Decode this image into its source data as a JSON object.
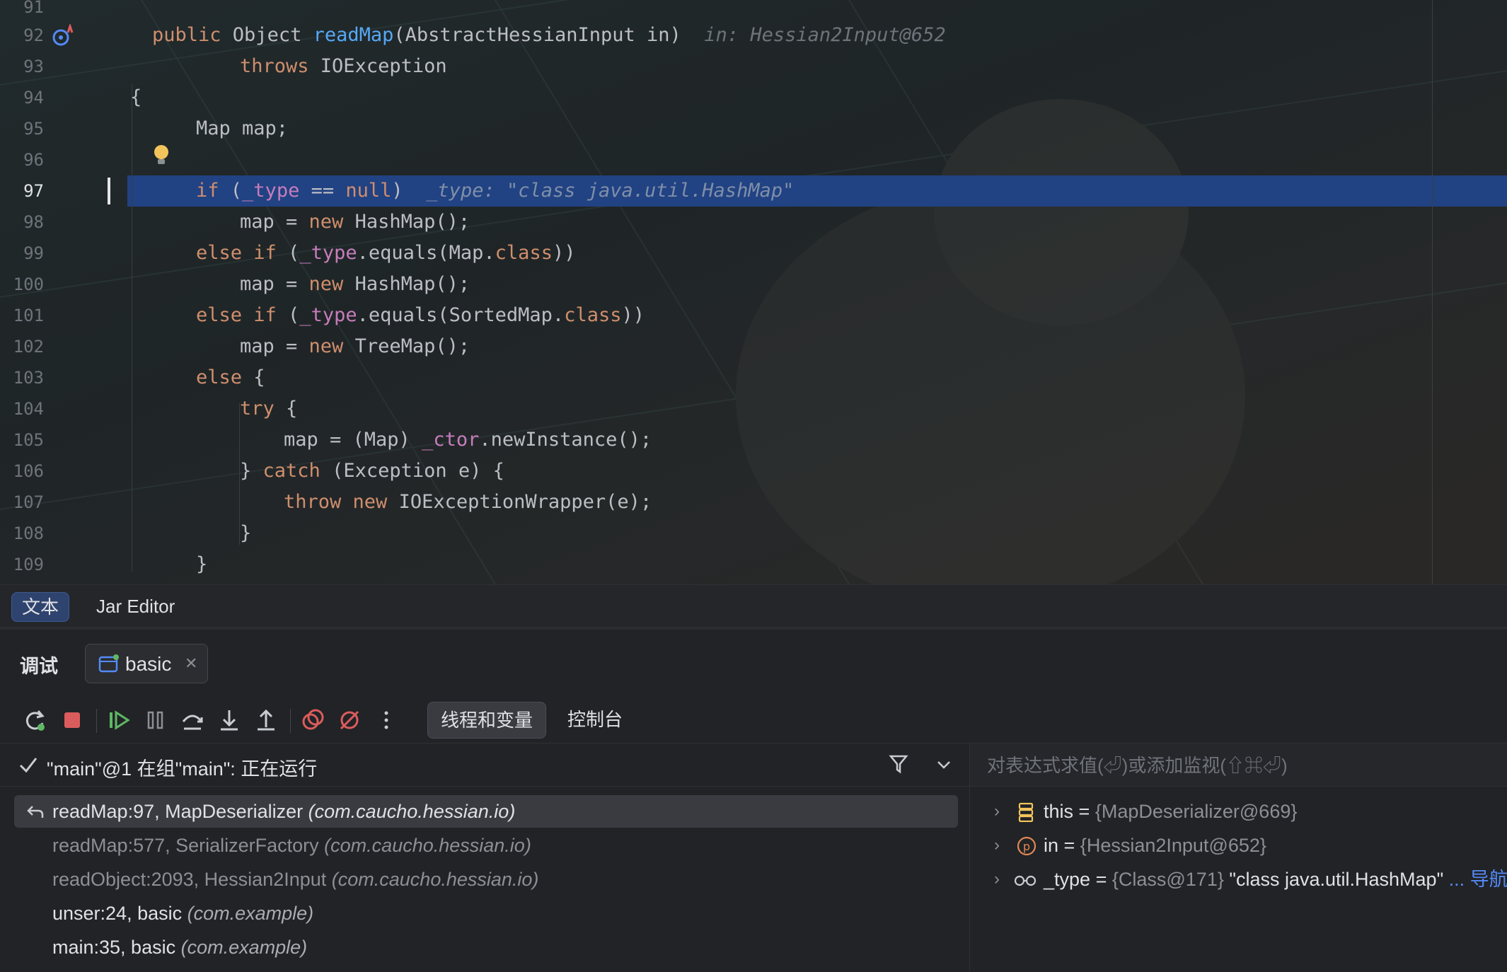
{
  "editor": {
    "lines": [
      {
        "num": "91"
      },
      {
        "num": "92"
      },
      {
        "num": "93"
      },
      {
        "num": "94"
      },
      {
        "num": "95"
      },
      {
        "num": "96"
      },
      {
        "num": "97"
      },
      {
        "num": "98"
      },
      {
        "num": "99"
      },
      {
        "num": "100"
      },
      {
        "num": "101"
      },
      {
        "num": "102"
      },
      {
        "num": "103"
      },
      {
        "num": "104"
      },
      {
        "num": "105"
      },
      {
        "num": "106"
      },
      {
        "num": "107"
      },
      {
        "num": "108"
      },
      {
        "num": "109"
      }
    ],
    "code": {
      "l92_a": "public ",
      "l92_b": "Object ",
      "l92_c": "readMap",
      "l92_d": "(AbstractHessianInput in)",
      "l92_hint": "in: Hessian2Input@652",
      "l93_a": "throws ",
      "l93_b": "IOException",
      "l94": "{",
      "l95": "Map map;",
      "l97_a": "if ",
      "l97_b": "(",
      "l97_c": "_type",
      "l97_d": " == ",
      "l97_e": "null",
      "l97_f": ")",
      "l97_hint": "_type: \"class java.util.HashMap\"",
      "l98_a": "map = ",
      "l98_b": "new ",
      "l98_c": "HashMap();",
      "l99_a": "else if ",
      "l99_b": "(",
      "l99_c": "_type",
      "l99_d": ".equals(Map.",
      "l99_e": "class",
      "l99_f": "))",
      "l100_a": "map = ",
      "l100_b": "new ",
      "l100_c": "HashMap();",
      "l101_a": "else if ",
      "l101_b": "(",
      "l101_c": "_type",
      "l101_d": ".equals(SortedMap.",
      "l101_e": "class",
      "l101_f": "))",
      "l102_a": "map = ",
      "l102_b": "new ",
      "l102_c": "TreeMap();",
      "l103_a": "else ",
      "l103_b": "{",
      "l104_a": "try ",
      "l104_b": "{",
      "l105_a": "map = (Map) ",
      "l105_b": "_ctor",
      "l105_c": ".newInstance();",
      "l106_a": "} ",
      "l106_b": "catch ",
      "l106_c": "(Exception e) {",
      "l107_a": "throw ",
      "l107_b": "new ",
      "l107_c": "IOExceptionWrapper(e);",
      "l108": "}",
      "l109": "}"
    }
  },
  "editor_tabs": [
    {
      "label": "文本",
      "active": true
    },
    {
      "label": "Jar Editor",
      "active": false
    }
  ],
  "debug": {
    "title": "调试",
    "session": "basic",
    "view_tabs": [
      {
        "label": "线程和变量",
        "active": true
      },
      {
        "label": "控制台",
        "active": false
      }
    ],
    "thread_status": "\"main\"@1 在组\"main\": 正在运行",
    "frames": [
      {
        "name": "readMap:97, MapDeserializer ",
        "pkg": "(com.caucho.hessian.io)"
      },
      {
        "name": "readMap:577, SerializerFactory ",
        "pkg": "(com.caucho.hessian.io)"
      },
      {
        "name": "readObject:2093, Hessian2Input ",
        "pkg": "(com.caucho.hessian.io)"
      },
      {
        "name": "unser:24, basic ",
        "pkg": "(com.example)"
      },
      {
        "name": "main:35, basic ",
        "pkg": "(com.example)"
      }
    ],
    "eval_placeholder": "对表达式求值(⏎)或添加监视(⇧⌘⏎)",
    "variables": [
      {
        "name": "this",
        "eq": " = ",
        "value": "{MapDeserializer@669}",
        "icon": "field-list-icon"
      },
      {
        "name": "in",
        "eq": " = ",
        "value": "{Hessian2Input@652}",
        "icon": "parameter-icon"
      },
      {
        "name": "_type",
        "eq": " = ",
        "value": "{Class@171} ",
        "str": "\"class java.util.HashMap\"",
        "nav": " ... 导航",
        "icon": "watch-glasses-icon"
      }
    ]
  },
  "colors": {
    "keyword": "#cf8e6d",
    "method": "#56a8f5",
    "field": "#c77dbb",
    "highlight_row": "#214283",
    "link": "#548af7"
  }
}
